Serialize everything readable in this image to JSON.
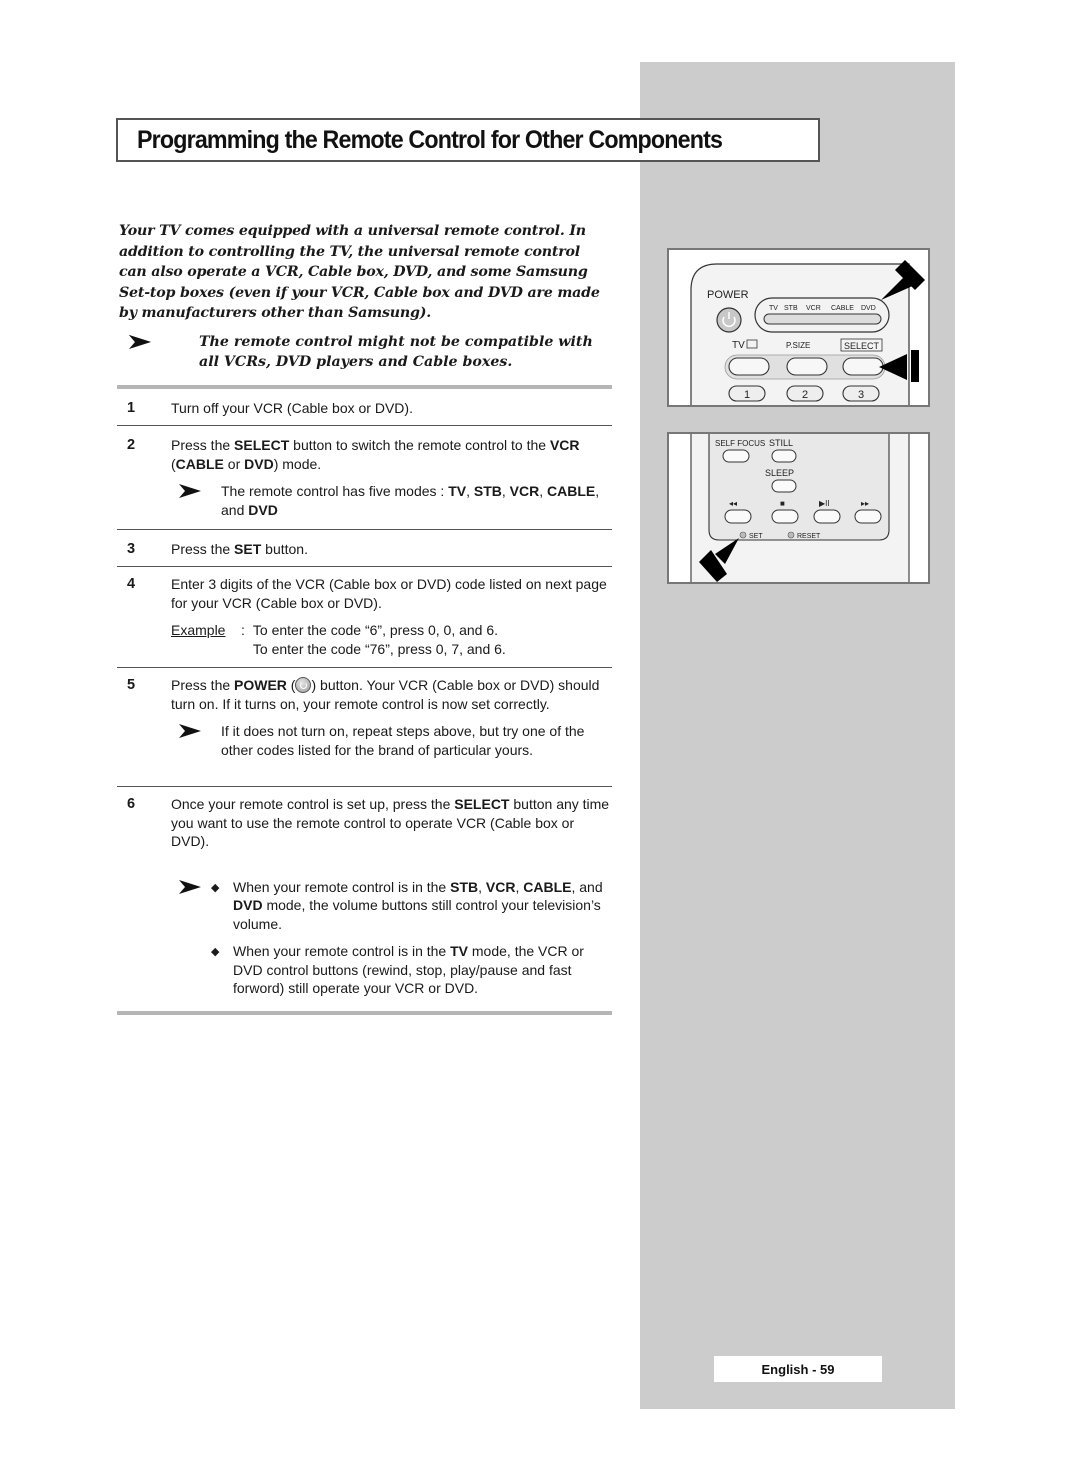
{
  "page": {
    "title": "Programming the Remote Control for Other Components",
    "page_label": "English - 59"
  },
  "intro": {
    "paragraph": "Your TV comes equipped with a universal remote control. In addition to controlling the TV, the universal remote control can also operate a VCR, Cable box, DVD, and some Samsung Set-top boxes (even if your VCR, Cable box and DVD are made by manufacturers other than Samsung).",
    "note": "The remote control might not be compatible with all VCRs, DVD players and Cable boxes."
  },
  "steps": [
    {
      "number": "1",
      "text": "Turn off your VCR (Cable box or DVD)."
    },
    {
      "number": "2",
      "text_parts": [
        "Press the ",
        "SELECT",
        " button to switch the remote control to the ",
        "VCR",
        " (",
        "CABLE",
        " or ",
        "DVD",
        ") mode."
      ],
      "note_parts": [
        "The remote control has five modes : ",
        "TV",
        ", ",
        "STB",
        ", ",
        "VCR",
        ", ",
        "CABLE",
        ", and ",
        "DVD"
      ]
    },
    {
      "number": "3",
      "text_parts": [
        "Press the ",
        "SET",
        " button."
      ]
    },
    {
      "number": "4",
      "text": "Enter 3 digits of the VCR (Cable box or DVD) code listed on next page for your VCR (Cable box or DVD).",
      "example_label": "Example",
      "example_lines": [
        "To enter the code “6”, press 0, 0, and 6.",
        "To enter the code “76”, press 0, 7, and 6."
      ]
    },
    {
      "number": "5",
      "text_parts": [
        "Press the ",
        "POWER",
        " (",
        ") button. Your VCR (Cable box or DVD) should turn on. If it turns on, your remote control is now set correctly."
      ],
      "note": "If it does not turn on, repeat steps above, but try one of the other codes listed for the brand of particular yours."
    },
    {
      "number": "6",
      "text_parts": [
        "Once your remote control is set up, press the ",
        "SELECT",
        " button any time you want to use the remote control to operate VCR (Cable box or DVD)."
      ],
      "bullet1_parts": [
        "When your remote control is in the ",
        "STB",
        ", ",
        "VCR",
        ", ",
        "CABLE",
        ", and ",
        "DVD",
        " mode, the volume buttons still control your television’s volume."
      ],
      "bullet2_parts": [
        "When your remote control is in the ",
        "TV",
        " mode, the VCR or DVD control buttons (rewind, stop, play/pause and fast forword) still operate your VCR or DVD."
      ]
    }
  ],
  "remote_top": {
    "power_label": "POWER",
    "modes": [
      "TV",
      "STB",
      "VCR",
      "CABLE",
      "DVD"
    ],
    "tv_label": "TV",
    "psize_label": "P.SIZE",
    "select_label": "SELECT",
    "number_keys": [
      "1",
      "2",
      "3"
    ]
  },
  "remote_bottom": {
    "self_focus_label": "SELF FOCUS",
    "still_label": "STILL",
    "sleep_label": "SLEEP",
    "transport_glyphs": [
      "◂◂",
      "■",
      "▶II",
      "▸▸"
    ],
    "set_label": "SET",
    "reset_label": "RESET"
  },
  "colors": {
    "side_panel": "#cccccc",
    "rule_thick": "#b5b5b5",
    "rule_thin": "#555555",
    "text": "#1a1a1a"
  }
}
